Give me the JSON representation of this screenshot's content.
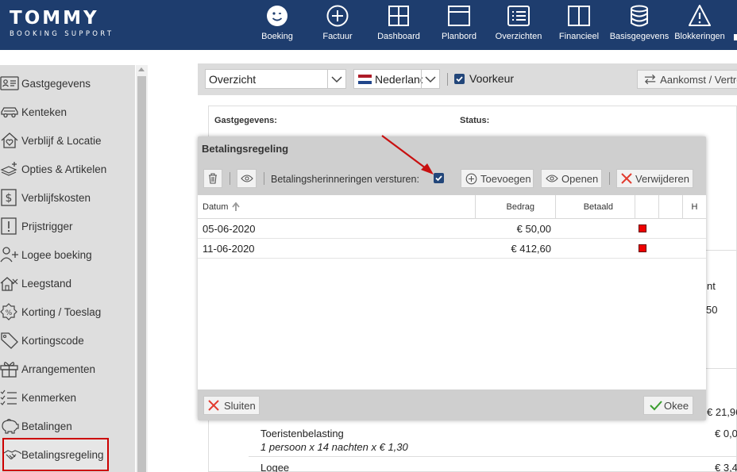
{
  "app": {
    "logo_main": "TOMMY",
    "logo_sub": "BOOKING SUPPORT"
  },
  "nav": [
    {
      "label": "Boeking",
      "icon": "smiley-icon"
    },
    {
      "label": "Factuur",
      "icon": "plus-circle-icon"
    },
    {
      "label": "Dashboard",
      "icon": "grid-icon"
    },
    {
      "label": "Planbord",
      "icon": "window-icon"
    },
    {
      "label": "Overzichten",
      "icon": "list-icon"
    },
    {
      "label": "Financieel",
      "icon": "columns-icon"
    },
    {
      "label": "Basisgegevens",
      "icon": "database-icon"
    },
    {
      "label": "Blokkeringen",
      "icon": "warning-icon"
    }
  ],
  "sidebar": {
    "items": [
      {
        "label": "Gastgegevens",
        "icon": "id-card-icon"
      },
      {
        "label": "Kenteken",
        "icon": "car-icon"
      },
      {
        "label": "Verblijf & Locatie",
        "icon": "house-heart-icon"
      },
      {
        "label": "Opties & Artikelen",
        "icon": "layers-plus-icon"
      },
      {
        "label": "Verblijfskosten",
        "icon": "dollar-box-icon"
      },
      {
        "label": "Prijstrigger",
        "icon": "exclamation-box-icon"
      },
      {
        "label": "Logee boeking",
        "icon": "person-plus-icon"
      },
      {
        "label": "Leegstand",
        "icon": "empty-house-icon"
      },
      {
        "label": "Korting / Toeslag",
        "icon": "percent-badge-icon"
      },
      {
        "label": "Kortingscode",
        "icon": "tag-icon"
      },
      {
        "label": "Arrangementen",
        "icon": "gift-icon"
      },
      {
        "label": "Kenmerken",
        "icon": "checklist-icon"
      },
      {
        "label": "Betalingen",
        "icon": "piggy-bank-icon"
      },
      {
        "label": "Betalingsregeling",
        "icon": "handshake-icon",
        "active": true
      }
    ]
  },
  "toolbar": {
    "view_select": "Overzicht",
    "language_select": "Nederland",
    "voorkeur_label": "Voorkeur",
    "voorkeur_checked": true,
    "arrival_button": "Aankomst / Vertrek"
  },
  "panel": {
    "guest_label": "Gastgegevens:",
    "status_label": "Status:",
    "partial_1": "nt",
    "partial_2": "50",
    "lines": [
      {
        "amount": "€ 21,96"
      },
      {
        "title": "Toeristenbelasting",
        "detail": "1 persoon x 14 nachten x € 1,30",
        "amount": "€ 0,0"
      },
      {
        "title": "Logee",
        "amount": "€ 3,4"
      }
    ]
  },
  "modal": {
    "title": "Betalingsregeling",
    "reminders_label": "Betalingsherinneringen versturen:",
    "reminders_checked": true,
    "add_button": "Toevoegen",
    "open_button": "Openen",
    "delete_button": "Verwijderen",
    "close_button": "Sluiten",
    "ok_button": "Okee",
    "columns": {
      "date": "Datum",
      "amount": "Bedrag",
      "paid": "Betaald",
      "h": "H"
    },
    "rows": [
      {
        "date": "05-06-2020",
        "amount": "€ 50,00",
        "paid_status": "unpaid"
      },
      {
        "date": "11-06-2020",
        "amount": "€ 412,60",
        "paid_status": "unpaid"
      }
    ]
  },
  "colors": {
    "topbar": "#1e3d6e",
    "accent_red": "#cc0000",
    "unpaid": "#e00000"
  }
}
